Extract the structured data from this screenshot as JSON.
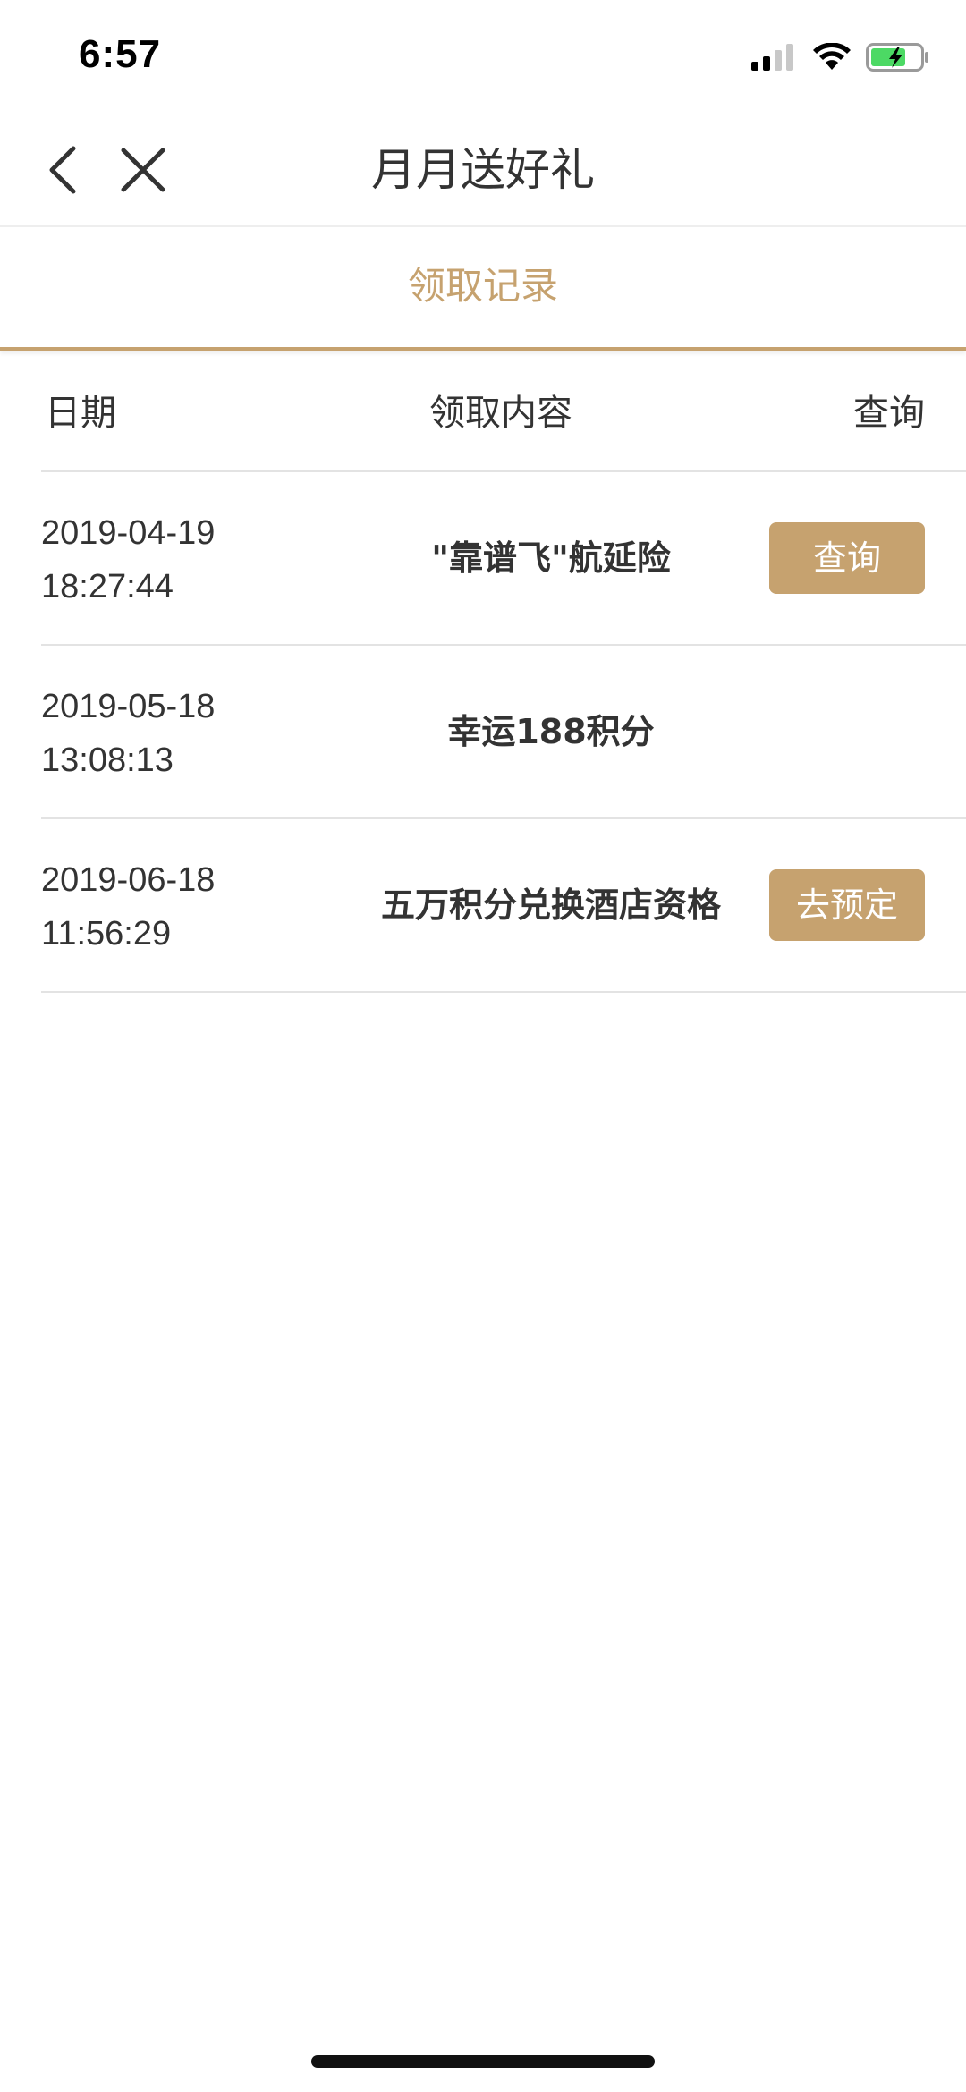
{
  "status_bar": {
    "time": "6:57",
    "icons": [
      "cellular-signal-icon",
      "wifi-icon",
      "battery-charging-icon"
    ],
    "battery_color": "#4cd964"
  },
  "nav": {
    "title": "月月送好礼",
    "icons": [
      "chevron-left-icon",
      "close-icon"
    ]
  },
  "tab": {
    "label": "领取记录",
    "accent_color": "#c6a26f"
  },
  "table": {
    "headers": {
      "date": "日期",
      "content": "领取内容",
      "action": "查询"
    },
    "rows": [
      {
        "date": "2019-04-19",
        "time": "18:27:44",
        "content": "\"靠谱飞\"航延险",
        "action": "查询"
      },
      {
        "date": "2019-05-18",
        "time": "13:08:13",
        "content": "幸运188积分",
        "action": ""
      },
      {
        "date": "2019-06-18",
        "time": "11:56:29",
        "content": "五万积分兑换酒店资格",
        "action": "去预定"
      }
    ]
  }
}
